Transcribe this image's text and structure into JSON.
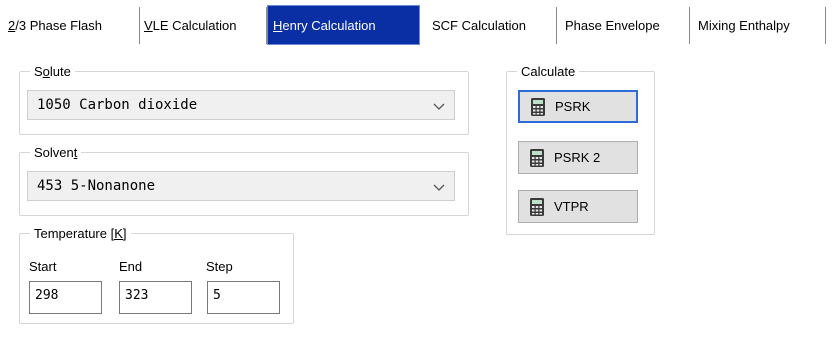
{
  "tabs": [
    {
      "key": "2",
      "rest": "/3 Phase Flash"
    },
    {
      "key": "V",
      "rest": "LE Calculation"
    },
    {
      "key": "H",
      "rest": "enry Calculation",
      "active": true
    },
    {
      "key": "",
      "rest": "SCF Calculation"
    },
    {
      "key": "",
      "rest": "Phase Envelope"
    },
    {
      "key": "",
      "rest": "Mixing Enthalpy"
    }
  ],
  "solute": {
    "legend_pre": "S",
    "legend_key": "o",
    "legend_post": "lute",
    "value": "1050 Carbon dioxide"
  },
  "solvent": {
    "legend_pre": "Solven",
    "legend_key": "t",
    "legend_post": "",
    "value": "453 5-Nonanone"
  },
  "temperature": {
    "legend_pre": "Temperature ",
    "legend_key": "[K]",
    "start_label": "Start",
    "end_label": "End",
    "step_label": "Step",
    "start_value": "298",
    "end_value": "323",
    "step_value": "5"
  },
  "calculate": {
    "legend": "Calculate",
    "buttons": [
      "PSRK",
      "PSRK 2",
      "VTPR"
    ],
    "icon": "calculator-icon"
  },
  "colors": {
    "active_tab": "#0a2ea3",
    "focus_border": "#2f6ad8"
  }
}
